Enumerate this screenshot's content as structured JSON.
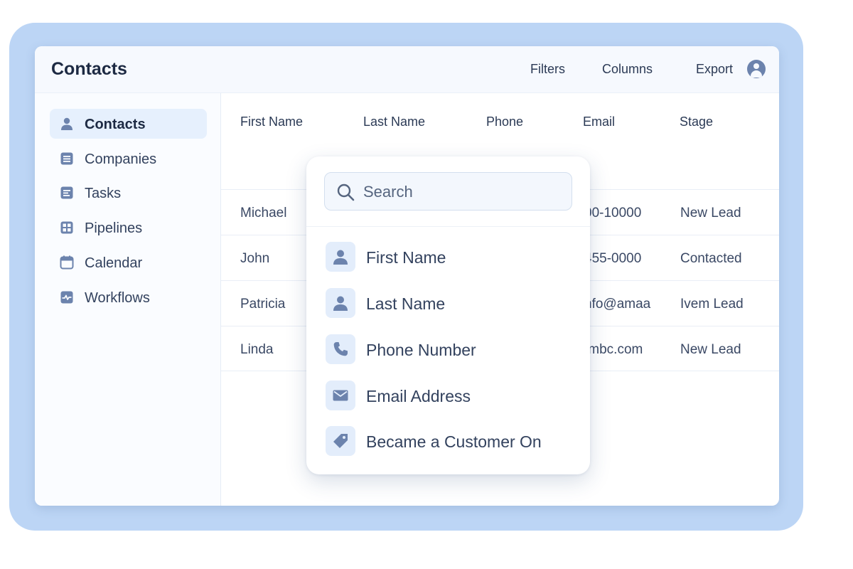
{
  "app": {
    "title": "Contacts"
  },
  "toolbar": {
    "filters": "Filters",
    "columns": "Columns",
    "export": "Export"
  },
  "sidebar": {
    "items": [
      {
        "label": "Contacts",
        "icon": "person-icon"
      },
      {
        "label": "Companies",
        "icon": "list-icon"
      },
      {
        "label": "Tasks",
        "icon": "checklist-icon"
      },
      {
        "label": "Pipelines",
        "icon": "grid-icon"
      },
      {
        "label": "Calendar",
        "icon": "calendar-icon"
      },
      {
        "label": "Workflows",
        "icon": "workflow-icon"
      }
    ]
  },
  "table": {
    "headers": [
      "First Name",
      "Last Name",
      "Phone",
      "Email",
      "Stage"
    ],
    "rows": [
      {
        "first": "Michael",
        "email": "00-10000",
        "stage": "New Lead"
      },
      {
        "first": "John",
        "email": "455-0000",
        "stage": "Contacted"
      },
      {
        "first": "Patricia",
        "email": "nfo@amaa",
        "stage": "Ivem Lead"
      },
      {
        "first": "Linda",
        "email": "ımbc.com",
        "stage": "New Lead"
      }
    ]
  },
  "dropdown": {
    "search_placeholder": "Search",
    "items": [
      {
        "label": "First Name",
        "icon": "person-icon"
      },
      {
        "label": "Last Name",
        "icon": "person-icon"
      },
      {
        "label": "Phone Number",
        "icon": "phone-icon"
      },
      {
        "label": "Email Address",
        "icon": "envelope-icon"
      },
      {
        "label": "Became a Customer On",
        "icon": "tag-icon"
      }
    ]
  },
  "colors": {
    "accent": "#6c83ad",
    "backdrop": "#bcd5f5",
    "active_item": "#e6f0fd",
    "text": "#2b3a55"
  }
}
